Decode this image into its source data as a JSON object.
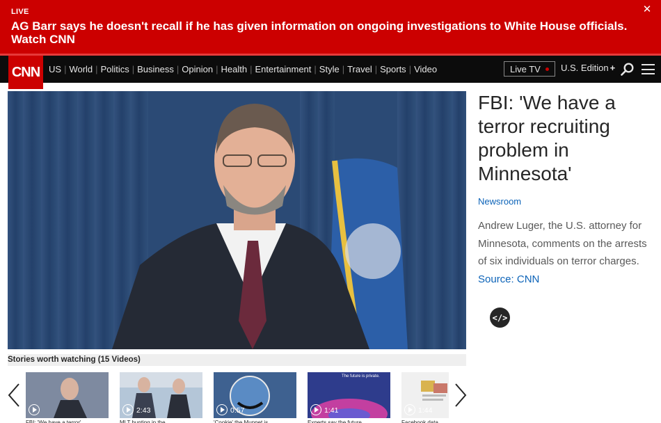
{
  "banner": {
    "live_label": "LIVE",
    "headline": "AG Barr says he doesn't recall if he has given information on ongoing investigations to White House officials. Watch CNN",
    "close_glyph": "✕"
  },
  "nav": {
    "logo_text": "CNN",
    "links": [
      "US",
      "World",
      "Politics",
      "Business",
      "Opinion",
      "Health",
      "Entertainment",
      "Style",
      "Travel",
      "Sports",
      "Video"
    ],
    "live_tv": "Live TV",
    "edition": "U.S. Edition",
    "edition_plus": "+"
  },
  "video": {
    "title": "FBI: 'We have a terror recruiting problem in Minnesota'",
    "source": "Newsroom",
    "description": "Andrew Luger, the U.S. attorney for Minnesota, comments on the arrests of six individuals on terror charges.",
    "source_label": "Source:",
    "source_link": "CNN",
    "embed_glyph": "</>"
  },
  "playlist": {
    "header": "Stories worth watching (15 Videos)",
    "items": [
      {
        "duration": "",
        "caption": "FBI: 'We have a terror'"
      },
      {
        "duration": "2:43",
        "caption": "MLT hunting in the"
      },
      {
        "duration": "0:57",
        "caption": "'Cookie' the Muppet is"
      },
      {
        "duration": "1:41",
        "caption": "Experts say the future"
      },
      {
        "duration": "1:44",
        "caption": "Facebook data"
      }
    ],
    "thumb_texts": {
      "ad_text": "The future is private."
    }
  },
  "colors": {
    "brand_red": "#cc0000",
    "link_blue": "#0c63b8",
    "nav_bg": "#0c0c0c"
  }
}
